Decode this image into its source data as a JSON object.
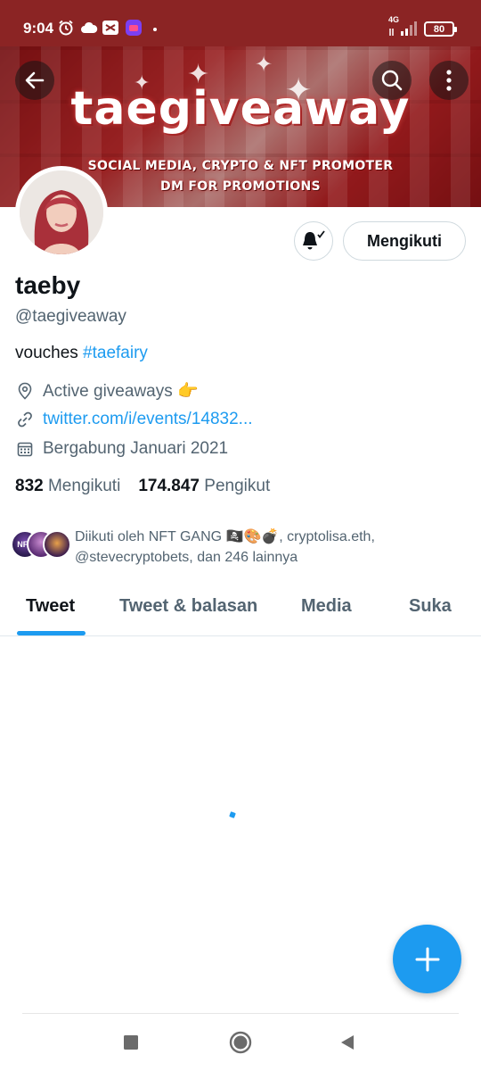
{
  "status_bar": {
    "time": "9:04",
    "network": "4G",
    "battery": "80",
    "icons": [
      "alarm-icon",
      "cloud-icon",
      "capcut-icon",
      "app-icon"
    ]
  },
  "banner": {
    "title": "taegiveaway",
    "tagline_1": "SOCIAL MEDIA, CRYPTO & NFT PROMOTER",
    "tagline_2": "DM FOR PROMOTIONS"
  },
  "profile": {
    "display_name": "taeby",
    "handle": "@taegiveaway",
    "bio_text": "vouches ",
    "bio_hashtag": "#taefairy",
    "location": "Active giveaways 👉",
    "link": "twitter.com/i/events/14832...",
    "joined": "Bergabung Januari 2021",
    "following_count": "832",
    "following_label": "Mengikuti",
    "followers_count": "174.847",
    "followers_label": "Pengikut",
    "follow_button_label": "Mengikuti",
    "followed_by_avatar_text": "NFT",
    "followed_by": "Diikuti oleh NFT GANG 🏴‍☠️🎨💣, cryptolisa.eth, @stevecryptobets, dan 246 lainnya"
  },
  "tabs": [
    {
      "label": "Tweet",
      "active": true
    },
    {
      "label": "Tweet & balasan",
      "active": false
    },
    {
      "label": "Media",
      "active": false
    },
    {
      "label": "Suka",
      "active": false
    }
  ],
  "colors": {
    "status_bar": "#8b2424",
    "accent": "#1d9bf0",
    "text_primary": "#0f1419",
    "text_secondary": "#536471"
  }
}
